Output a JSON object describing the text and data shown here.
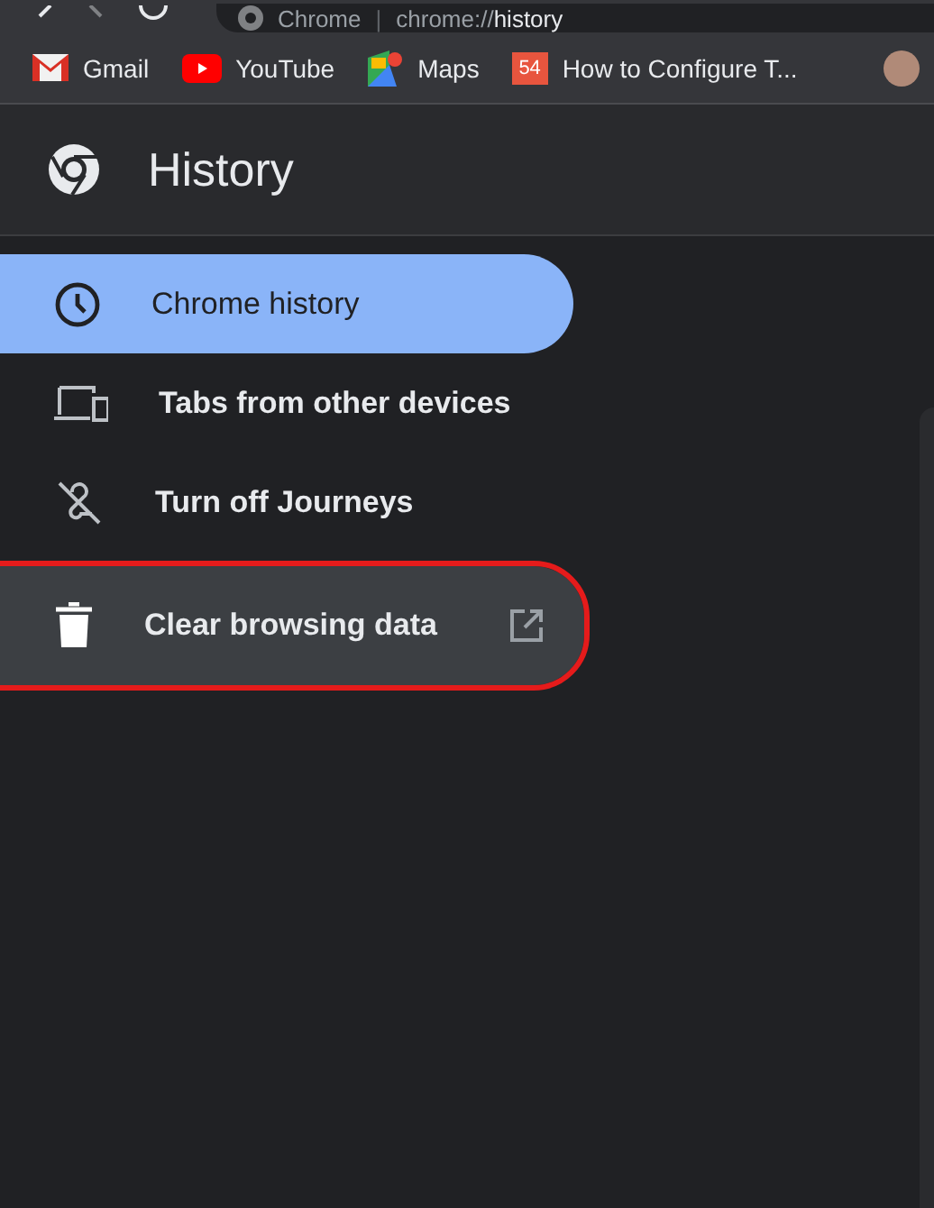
{
  "address_bar": {
    "site": "Chrome",
    "separator": "|",
    "url_host": "chrome://",
    "url_path": "history"
  },
  "bookmarks": [
    {
      "label": "Gmail",
      "kind": "mail"
    },
    {
      "label": "YouTube",
      "kind": "video"
    },
    {
      "label": "Maps",
      "kind": "map"
    },
    {
      "label": "How to Configure T...",
      "kind": "badge",
      "badge": "54"
    }
  ],
  "header": {
    "title": "History"
  },
  "sidebar": {
    "items": [
      {
        "label": "Chrome history",
        "kind": "clock",
        "selected": true,
        "hovered": false,
        "external": false,
        "outlined": false
      },
      {
        "label": "Tabs from other devices",
        "kind": "devices",
        "selected": false,
        "hovered": false,
        "external": false,
        "outlined": false
      },
      {
        "label": "Turn off Journeys",
        "kind": "journeys-off",
        "selected": false,
        "hovered": false,
        "external": false,
        "outlined": false
      },
      {
        "label": "Clear browsing data",
        "kind": "trash",
        "selected": false,
        "hovered": true,
        "external": true,
        "outlined": true
      }
    ]
  }
}
